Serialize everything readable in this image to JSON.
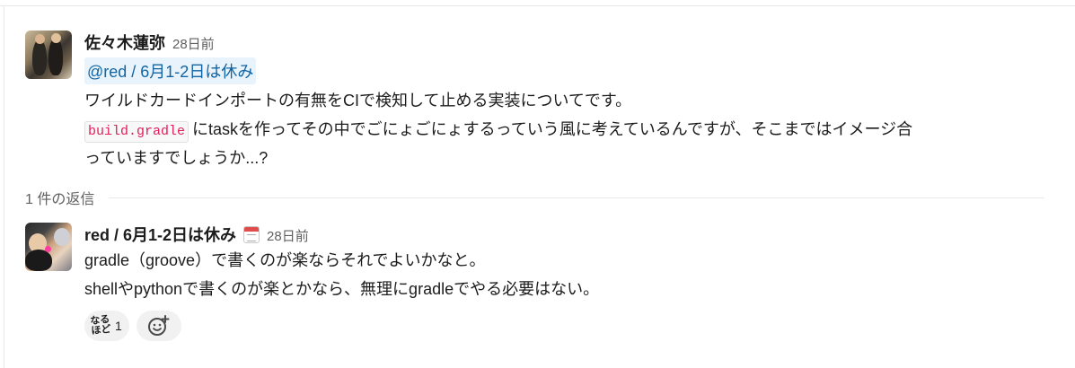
{
  "thread": {
    "parent": {
      "author": "佐々木蓮弥",
      "timestamp": "28日前",
      "mention": "@red / 6月1-2日は休み",
      "line1": "ワイルドカードインポートの有無をCIで検知して止める実装についてです。",
      "code": "build.gradle",
      "line2": "にtaskを作ってその中でごにょごにょするっていう風に考えているんですが、そこまではイメージ合",
      "line3": "っていますでしょうか...?"
    },
    "replies_label": "1 件の返信",
    "reply": {
      "author": "red / 6月1-2日は休み",
      "status_icon": "calendar-icon",
      "timestamp": "28日前",
      "line1": "gradle（groove）で書くのが楽ならそれでよいかなと。",
      "line2": "shellやpythonで書くのが楽とかなら、無理にgradleでやる必要はない。",
      "reactions": [
        {
          "emoji_top": "なる",
          "emoji_bottom": "ほど",
          "count": "1"
        }
      ],
      "add_reaction_icon": "add-emoji-icon"
    }
  },
  "colors": {
    "mention_bg": "#e8f3fb",
    "mention_text": "#1264a3",
    "code_text": "#e01e5a",
    "timestamp": "#616061"
  }
}
